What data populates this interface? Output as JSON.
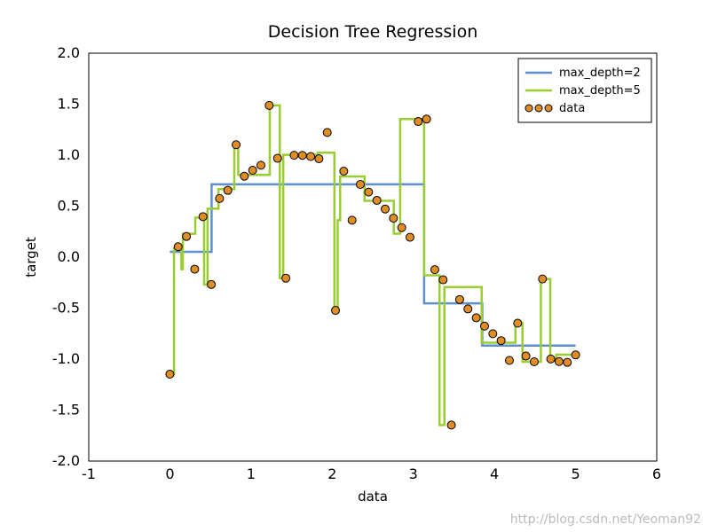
{
  "chart_data": {
    "type": "line",
    "title": "Decision Tree Regression",
    "xlabel": "data",
    "ylabel": "target",
    "xlim": [
      -1,
      6
    ],
    "ylim": [
      -2,
      2
    ],
    "xticks": [
      -1,
      0,
      1,
      2,
      3,
      4,
      5,
      6
    ],
    "yticks": [
      -2.0,
      -1.5,
      -1.0,
      -0.5,
      0.0,
      0.5,
      1.0,
      1.5,
      2.0
    ],
    "legend": {
      "position": "upper right",
      "entries": [
        "max_depth=2",
        "max_depth=5",
        "data"
      ]
    },
    "colors": {
      "depth2": "#5f8fd1",
      "depth5": "#9acd32",
      "data_face": "#e08c27",
      "data_edge": "#000000"
    },
    "series": [
      {
        "name": "max_depth=2",
        "type": "step",
        "x": [
          0.0,
          0.514,
          0.514,
          3.133,
          3.133,
          3.85,
          3.85,
          5.0
        ],
        "y": [
          0.052,
          0.052,
          0.714,
          0.714,
          -0.453,
          -0.453,
          -0.867,
          -0.867
        ]
      },
      {
        "name": "max_depth=5",
        "type": "step",
        "x": [
          0.0,
          0.051,
          0.051,
          0.142,
          0.142,
          0.16,
          0.16,
          0.313,
          0.313,
          0.422,
          0.422,
          0.464,
          0.464,
          0.599,
          0.599,
          0.794,
          0.794,
          0.842,
          0.842,
          1.231,
          1.231,
          1.355,
          1.355,
          1.397,
          1.397,
          1.819,
          1.819,
          2.028,
          2.028,
          2.068,
          2.068,
          2.098,
          2.098,
          2.399,
          2.399,
          2.759,
          2.759,
          2.838,
          2.838,
          3.133,
          3.133,
          3.323,
          3.323,
          3.383,
          3.383,
          3.842,
          3.842,
          4.258,
          4.258,
          4.345,
          4.345,
          4.572,
          4.572,
          4.688,
          4.688,
          4.762,
          4.762,
          5.0
        ],
        "y": [
          -1.148,
          -1.148,
          0.089,
          0.089,
          -0.118,
          -0.118,
          0.229,
          0.229,
          0.388,
          0.388,
          -0.268,
          -0.268,
          0.475,
          0.475,
          0.667,
          0.667,
          1.102,
          1.102,
          0.806,
          0.806,
          1.488,
          1.488,
          -0.206,
          -0.206,
          1.003,
          1.003,
          1.024,
          1.024,
          -0.522,
          -0.522,
          0.362,
          0.362,
          0.791,
          0.791,
          0.552,
          0.552,
          0.23,
          0.23,
          1.354,
          1.354,
          -0.178,
          -0.178,
          -1.647,
          -1.647,
          -0.293,
          -0.293,
          -0.839,
          -0.839,
          -0.648,
          -0.648,
          -1.026,
          -1.026,
          -0.214,
          -0.214,
          -0.999,
          -0.999,
          -0.957,
          -0.957
        ]
      }
    ],
    "scatter": {
      "name": "data",
      "x": [
        0.0,
        0.102,
        0.204,
        0.306,
        0.408,
        0.51,
        0.612,
        0.714,
        0.816,
        0.918,
        1.02,
        1.122,
        1.224,
        1.327,
        1.429,
        1.531,
        1.633,
        1.735,
        1.837,
        1.939,
        2.041,
        2.143,
        2.245,
        2.347,
        2.449,
        2.551,
        2.653,
        2.755,
        2.857,
        2.959,
        3.061,
        3.163,
        3.265,
        3.367,
        3.469,
        3.571,
        3.673,
        3.776,
        3.878,
        3.98,
        4.082,
        4.184,
        4.286,
        4.388,
        4.49,
        4.592,
        4.694,
        4.796,
        4.898,
        5.0
      ],
      "y": [
        -1.148,
        0.102,
        0.203,
        -0.118,
        0.397,
        -0.268,
        0.575,
        0.655,
        1.102,
        0.794,
        0.852,
        0.901,
        1.488,
        0.969,
        -0.206,
        0.999,
        0.998,
        0.987,
        0.965,
        1.223,
        -0.522,
        0.843,
        0.362,
        0.713,
        0.638,
        0.557,
        0.472,
        0.382,
        0.289,
        0.195,
        1.33,
        1.354,
        -0.123,
        -0.222,
        -1.647,
        -0.416,
        -0.508,
        -0.595,
        -0.676,
        -0.751,
        -0.819,
        -1.013,
        -0.648,
        -0.97,
        -1.026,
        -0.214,
        -0.999,
        -1.024,
        -1.032,
        -0.959
      ]
    }
  },
  "watermark": "http://blog.csdn.net/Yeoman92"
}
